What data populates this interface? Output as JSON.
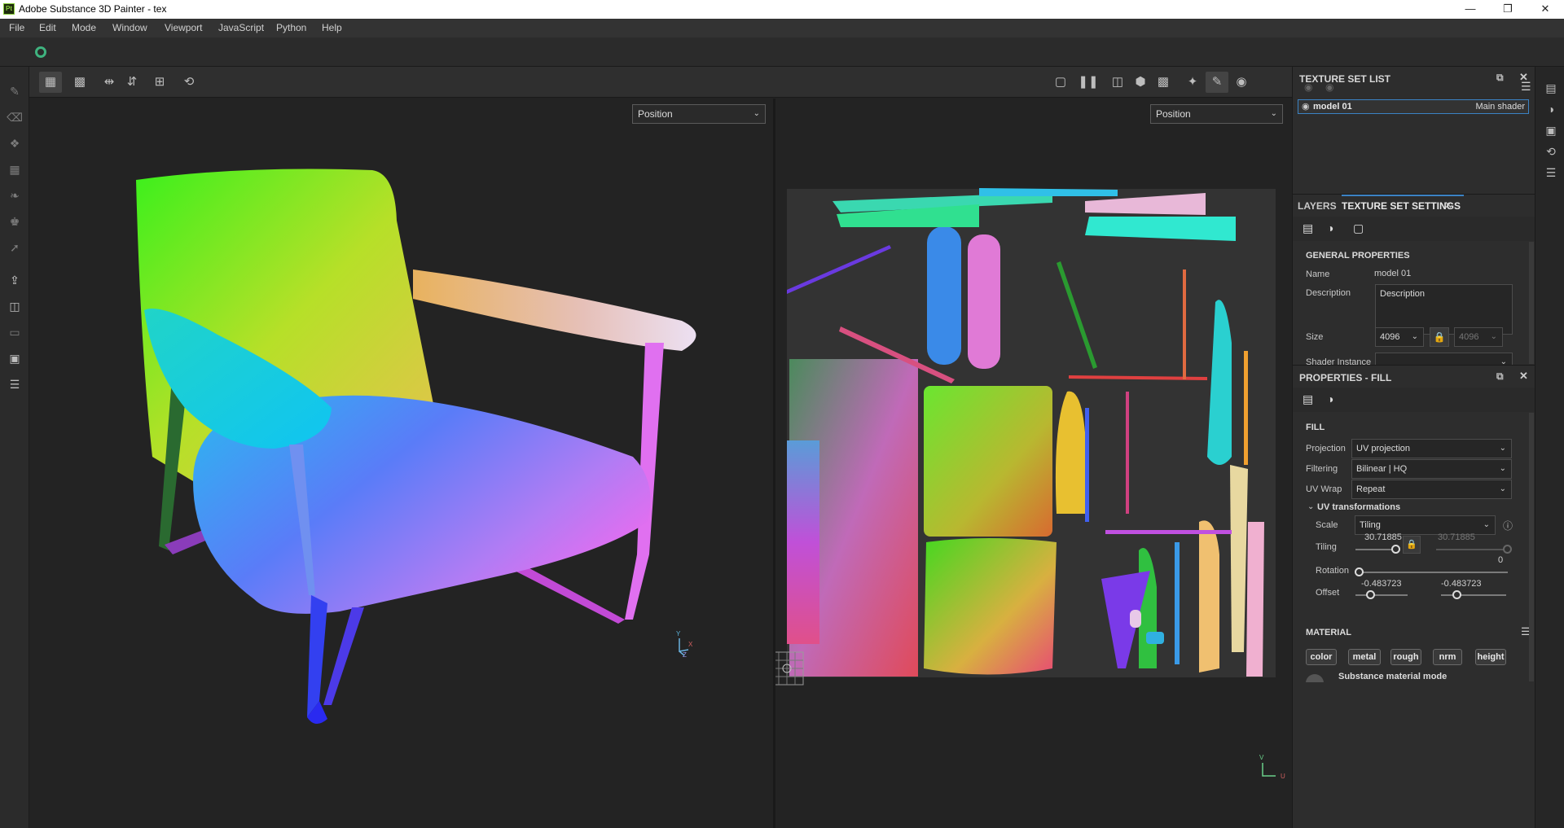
{
  "window": {
    "title": "Adobe Substance 3D Painter - tex",
    "app_icon": "Pt"
  },
  "menu": [
    "File",
    "Edit",
    "Mode",
    "Window",
    "Viewport",
    "JavaScript",
    "Python",
    "Help"
  ],
  "viewport": {
    "left_channel": "Position",
    "right_channel": "Position",
    "axes_3d": {
      "y": "Y",
      "x": "X",
      "z": "Z"
    },
    "axes_uv": {
      "v": "V",
      "u": "U"
    }
  },
  "texture_set_list": {
    "title": "TEXTURE SET LIST",
    "item_name": "model 01",
    "item_shader": "Main shader"
  },
  "tabs": {
    "layers": "LAYERS",
    "texture_set_settings": "TEXTURE SET SETTINGS"
  },
  "general": {
    "heading": "GENERAL PROPERTIES",
    "name_label": "Name",
    "name_value": "model 01",
    "description_label": "Description",
    "description_value": "Description",
    "size_label": "Size",
    "size_value": "4096",
    "size_locked_value": "4096",
    "shader_label": "Shader Instance"
  },
  "fill": {
    "panel_title": "PROPERTIES - FILL",
    "heading": "FILL",
    "projection_label": "Projection",
    "projection_value": "UV projection",
    "filtering_label": "Filtering",
    "filtering_value": "Bilinear | HQ",
    "uvwrap_label": "UV Wrap",
    "uvwrap_value": "Repeat",
    "uvt_heading": "UV transformations",
    "scale_label": "Scale",
    "scale_value": "Tiling",
    "tiling_label": "Tiling",
    "tiling_value": "30.71885",
    "tiling_value2": "30.71885",
    "rotation_label": "Rotation",
    "rotation_value": "0",
    "offset_label": "Offset",
    "offset_u": "-0.483723",
    "offset_v": "-0.483723"
  },
  "material": {
    "heading": "MATERIAL",
    "channels": [
      "color",
      "metal",
      "rough",
      "nrm",
      "height"
    ],
    "substance_mode": "Substance material mode"
  },
  "colors": {
    "accent": "#3b82c4",
    "panel": "#2d2d2d",
    "viewport": "#232323"
  }
}
